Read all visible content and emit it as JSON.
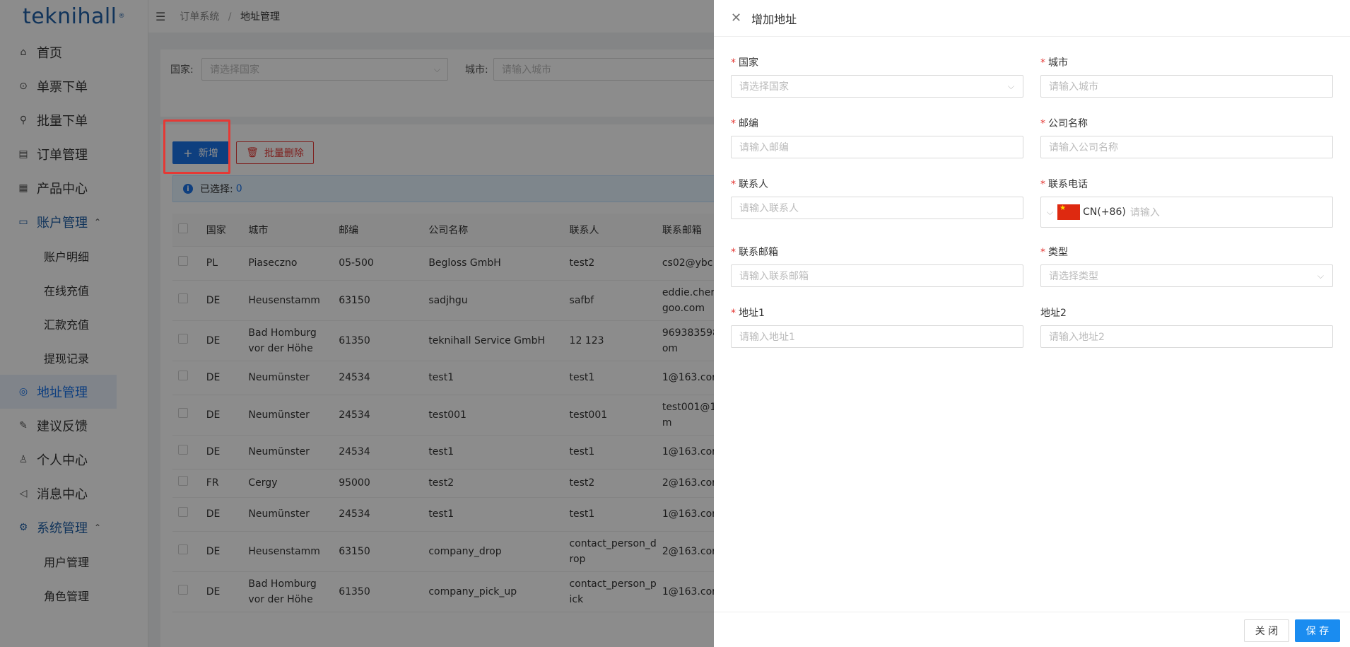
{
  "logo": {
    "text": "teknihall",
    "mark": "®"
  },
  "sidebar": {
    "items": [
      {
        "label": "首页",
        "icon": "home-icon",
        "type": "top"
      },
      {
        "label": "单票下单",
        "icon": "order-single-icon",
        "type": "top"
      },
      {
        "label": "批量下单",
        "icon": "rocket-icon",
        "type": "top"
      },
      {
        "label": "订单管理",
        "icon": "order-list-icon",
        "type": "top"
      },
      {
        "label": "产品中心",
        "icon": "grid-icon",
        "type": "top"
      },
      {
        "label": "账户管理",
        "icon": "id-card-icon",
        "type": "group"
      },
      {
        "label": "账户明细",
        "type": "sub"
      },
      {
        "label": "在线充值",
        "type": "sub"
      },
      {
        "label": "汇款充值",
        "type": "sub"
      },
      {
        "label": "提现记录",
        "type": "sub"
      },
      {
        "label": "地址管理",
        "icon": "location-icon",
        "type": "active"
      },
      {
        "label": "建议反馈",
        "icon": "edit-icon",
        "type": "top"
      },
      {
        "label": "个人中心",
        "icon": "user-icon",
        "type": "top"
      },
      {
        "label": "消息中心",
        "icon": "megaphone-icon",
        "type": "top"
      },
      {
        "label": "系统管理",
        "icon": "settings-icon",
        "type": "group"
      },
      {
        "label": "用户管理",
        "type": "sub"
      },
      {
        "label": "角色管理",
        "type": "sub"
      }
    ]
  },
  "breadcrumb": {
    "parent": "订单系统",
    "separator": "/",
    "current": "地址管理"
  },
  "filter": {
    "country_label": "国家:",
    "country_placeholder": "请选择国家",
    "city_label": "城市:",
    "city_placeholder": "请输入城市"
  },
  "toolbar": {
    "add_label": "新增",
    "batch_delete_label": "批量删除"
  },
  "selection": {
    "label": "已选择:",
    "count": "0"
  },
  "table": {
    "columns": [
      "国家",
      "城市",
      "邮编",
      "公司名称",
      "联系人",
      "联系邮箱"
    ],
    "rows": [
      [
        "PL",
        "Piaseczno",
        "05-500",
        "Begloss GmbH",
        "test2",
        "cs02@ybc"
      ],
      [
        "DE",
        "Heusenstamm",
        "63150",
        "sadjhgu",
        "safbf",
        "eddie.cher goo.com"
      ],
      [
        "DE",
        "Bad Homburg vor der Höhe",
        "61350",
        "teknihall Service GmbH",
        "12 123",
        "969383598 om"
      ],
      [
        "DE",
        "Neumünster",
        "24534",
        "test1",
        "test1",
        "1@163.cor"
      ],
      [
        "DE",
        "Neumünster",
        "24534",
        "test001",
        "test001",
        "test001@1 m"
      ],
      [
        "DE",
        "Neumünster",
        "24534",
        "test1",
        "test1",
        "1@163.cor"
      ],
      [
        "FR",
        "Cergy",
        "95000",
        "test2",
        "test2",
        "2@163.cor"
      ],
      [
        "DE",
        "Neumünster",
        "24534",
        "test1",
        "test1",
        "1@163.cor"
      ],
      [
        "DE",
        "Heusenstamm",
        "63150",
        "company_drop",
        "contact_person_d rop",
        "2@163.cor"
      ],
      [
        "DE",
        "Bad Homburg vor der Höhe",
        "61350",
        "company_pick_up",
        "contact_person_p ick",
        "1@163.cor"
      ]
    ]
  },
  "drawer": {
    "title": "增加地址",
    "fields": {
      "country": {
        "label": "国家",
        "required": true,
        "placeholder": "请选择国家"
      },
      "city": {
        "label": "城市",
        "required": true,
        "placeholder": "请输入城市"
      },
      "postcode": {
        "label": "邮编",
        "required": true,
        "placeholder": "请输入邮编"
      },
      "company": {
        "label": "公司名称",
        "required": true,
        "placeholder": "请输入公司名称"
      },
      "contact": {
        "label": "联系人",
        "required": true,
        "placeholder": "请输入联系人"
      },
      "phone": {
        "label": "联系电话",
        "required": true,
        "code": "CN(+86)",
        "placeholder": "请输入"
      },
      "email": {
        "label": "联系邮箱",
        "required": true,
        "placeholder": "请输入联系邮箱"
      },
      "type": {
        "label": "类型",
        "required": true,
        "placeholder": "请选择类型"
      },
      "address1": {
        "label": "地址1",
        "required": true,
        "placeholder": "请输入地址1"
      },
      "address2": {
        "label": "地址2",
        "required": false,
        "placeholder": "请输入地址2"
      }
    },
    "footer": {
      "close_label": "关 闭",
      "save_label": "保 存"
    }
  },
  "colors": {
    "primary": "#1a73e8",
    "danger": "#e53935",
    "required": "#e53935",
    "mask": "rgba(0,0,0,0.45)"
  }
}
